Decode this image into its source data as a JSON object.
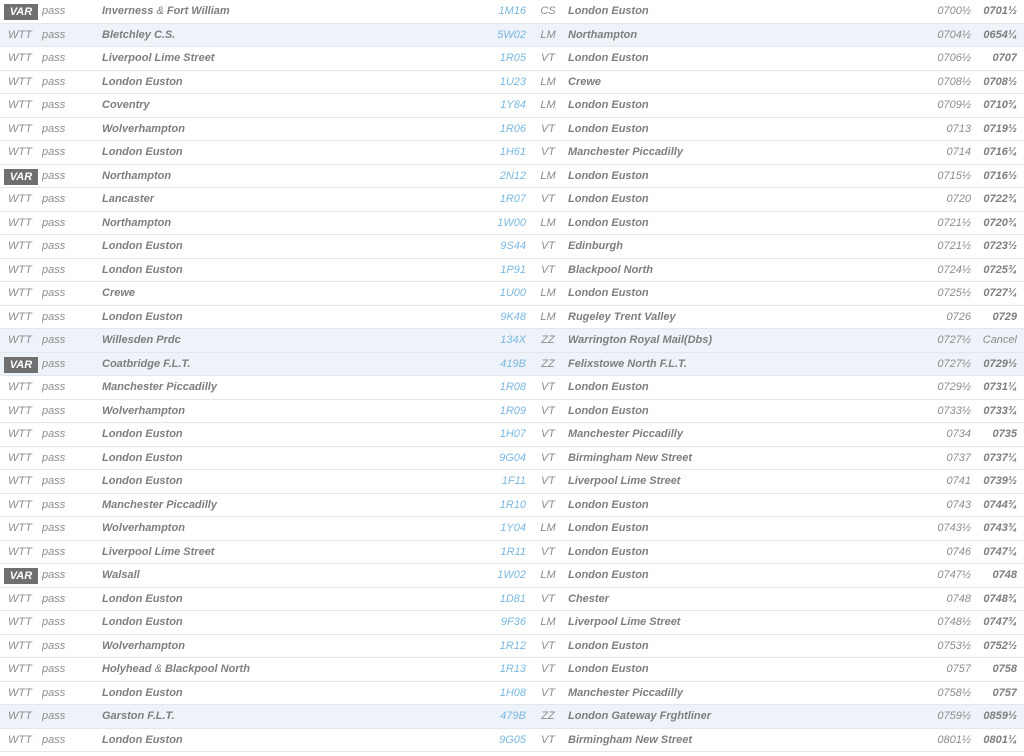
{
  "rows": [
    {
      "type": "VAR",
      "mode": "pass",
      "origin": "Inverness",
      "origin2": "Fort William",
      "headcode": "1M16",
      "operator": "CS",
      "destination": "London Euston",
      "booked": "0700½",
      "actual": "0701½",
      "shaded": false
    },
    {
      "type": "WTT",
      "mode": "pass",
      "origin": "Bletchley C.S.",
      "origin2": "",
      "headcode": "5W02",
      "operator": "LM",
      "destination": "Northampton",
      "booked": "0704½",
      "actual": "0654¼",
      "shaded": true
    },
    {
      "type": "WTT",
      "mode": "pass",
      "origin": "Liverpool Lime Street",
      "origin2": "",
      "headcode": "1R05",
      "operator": "VT",
      "destination": "London Euston",
      "booked": "0706½",
      "actual": "0707",
      "shaded": false
    },
    {
      "type": "WTT",
      "mode": "pass",
      "origin": "London Euston",
      "origin2": "",
      "headcode": "1U23",
      "operator": "LM",
      "destination": "Crewe",
      "booked": "0708½",
      "actual": "0708½",
      "shaded": false
    },
    {
      "type": "WTT",
      "mode": "pass",
      "origin": "Coventry",
      "origin2": "",
      "headcode": "1Y84",
      "operator": "LM",
      "destination": "London Euston",
      "booked": "0709½",
      "actual": "0710¾",
      "shaded": false
    },
    {
      "type": "WTT",
      "mode": "pass",
      "origin": "Wolverhampton",
      "origin2": "",
      "headcode": "1R06",
      "operator": "VT",
      "destination": "London Euston",
      "booked": "0713",
      "actual": "0719½",
      "shaded": false
    },
    {
      "type": "WTT",
      "mode": "pass",
      "origin": "London Euston",
      "origin2": "",
      "headcode": "1H61",
      "operator": "VT",
      "destination": "Manchester Piccadilly",
      "booked": "0714",
      "actual": "0716¼",
      "shaded": false
    },
    {
      "type": "VAR",
      "mode": "pass",
      "origin": "Northampton",
      "origin2": "",
      "headcode": "2N12",
      "operator": "LM",
      "destination": "London Euston",
      "booked": "0715½",
      "actual": "0716½",
      "shaded": false
    },
    {
      "type": "WTT",
      "mode": "pass",
      "origin": "Lancaster",
      "origin2": "",
      "headcode": "1R07",
      "operator": "VT",
      "destination": "London Euston",
      "booked": "0720",
      "actual": "0722¾",
      "shaded": false
    },
    {
      "type": "WTT",
      "mode": "pass",
      "origin": "Northampton",
      "origin2": "",
      "headcode": "1W00",
      "operator": "LM",
      "destination": "London Euston",
      "booked": "0721½",
      "actual": "0720¾",
      "shaded": false
    },
    {
      "type": "WTT",
      "mode": "pass",
      "origin": "London Euston",
      "origin2": "",
      "headcode": "9S44",
      "operator": "VT",
      "destination": "Edinburgh",
      "booked": "0721½",
      "actual": "0723½",
      "shaded": false
    },
    {
      "type": "WTT",
      "mode": "pass",
      "origin": "London Euston",
      "origin2": "",
      "headcode": "1P91",
      "operator": "VT",
      "destination": "Blackpool North",
      "booked": "0724½",
      "actual": "0725¾",
      "shaded": false
    },
    {
      "type": "WTT",
      "mode": "pass",
      "origin": "Crewe",
      "origin2": "",
      "headcode": "1U00",
      "operator": "LM",
      "destination": "London Euston",
      "booked": "0725½",
      "actual": "0727¼",
      "shaded": false
    },
    {
      "type": "WTT",
      "mode": "pass",
      "origin": "London Euston",
      "origin2": "",
      "headcode": "9K48",
      "operator": "LM",
      "destination": "Rugeley Trent Valley",
      "booked": "0726",
      "actual": "0729",
      "shaded": false
    },
    {
      "type": "WTT",
      "mode": "pass",
      "origin": "Willesden Prdc",
      "origin2": "",
      "headcode": "134X",
      "operator": "ZZ",
      "destination": "Warrington Royal Mail(Dbs)",
      "booked": "0727½",
      "actual": "Cancel",
      "shaded": true
    },
    {
      "type": "VAR",
      "mode": "pass",
      "origin": "Coatbridge F.L.T.",
      "origin2": "",
      "headcode": "419B",
      "operator": "ZZ",
      "destination": "Felixstowe North F.L.T.",
      "booked": "0727½",
      "actual": "0729½",
      "shaded": true
    },
    {
      "type": "WTT",
      "mode": "pass",
      "origin": "Manchester Piccadilly",
      "origin2": "",
      "headcode": "1R08",
      "operator": "VT",
      "destination": "London Euston",
      "booked": "0729½",
      "actual": "0731¼",
      "shaded": false
    },
    {
      "type": "WTT",
      "mode": "pass",
      "origin": "Wolverhampton",
      "origin2": "",
      "headcode": "1R09",
      "operator": "VT",
      "destination": "London Euston",
      "booked": "0733½",
      "actual": "0733¾",
      "shaded": false
    },
    {
      "type": "WTT",
      "mode": "pass",
      "origin": "London Euston",
      "origin2": "",
      "headcode": "1H07",
      "operator": "VT",
      "destination": "Manchester Piccadilly",
      "booked": "0734",
      "actual": "0735",
      "shaded": false
    },
    {
      "type": "WTT",
      "mode": "pass",
      "origin": "London Euston",
      "origin2": "",
      "headcode": "9G04",
      "operator": "VT",
      "destination": "Birmingham New Street",
      "booked": "0737",
      "actual": "0737¼",
      "shaded": false
    },
    {
      "type": "WTT",
      "mode": "pass",
      "origin": "London Euston",
      "origin2": "",
      "headcode": "1F11",
      "operator": "VT",
      "destination": "Liverpool Lime Street",
      "booked": "0741",
      "actual": "0739½",
      "shaded": false
    },
    {
      "type": "WTT",
      "mode": "pass",
      "origin": "Manchester Piccadilly",
      "origin2": "",
      "headcode": "1R10",
      "operator": "VT",
      "destination": "London Euston",
      "booked": "0743",
      "actual": "0744¾",
      "shaded": false
    },
    {
      "type": "WTT",
      "mode": "pass",
      "origin": "Wolverhampton",
      "origin2": "",
      "headcode": "1Y04",
      "operator": "LM",
      "destination": "London Euston",
      "booked": "0743½",
      "actual": "0743¾",
      "shaded": false
    },
    {
      "type": "WTT",
      "mode": "pass",
      "origin": "Liverpool Lime Street",
      "origin2": "",
      "headcode": "1R11",
      "operator": "VT",
      "destination": "London Euston",
      "booked": "0746",
      "actual": "0747¼",
      "shaded": false
    },
    {
      "type": "VAR",
      "mode": "pass",
      "origin": "Walsall",
      "origin2": "",
      "headcode": "1W02",
      "operator": "LM",
      "destination": "London Euston",
      "booked": "0747½",
      "actual": "0748",
      "shaded": false
    },
    {
      "type": "WTT",
      "mode": "pass",
      "origin": "London Euston",
      "origin2": "",
      "headcode": "1D81",
      "operator": "VT",
      "destination": "Chester",
      "booked": "0748",
      "actual": "0748¾",
      "shaded": false
    },
    {
      "type": "WTT",
      "mode": "pass",
      "origin": "London Euston",
      "origin2": "",
      "headcode": "9F36",
      "operator": "LM",
      "destination": "Liverpool Lime Street",
      "booked": "0748½",
      "actual": "0747¾",
      "shaded": false
    },
    {
      "type": "WTT",
      "mode": "pass",
      "origin": "Wolverhampton",
      "origin2": "",
      "headcode": "1R12",
      "operator": "VT",
      "destination": "London Euston",
      "booked": "0753½",
      "actual": "0752½",
      "shaded": false
    },
    {
      "type": "WTT",
      "mode": "pass",
      "origin": "Holyhead",
      "origin2": "Blackpool North",
      "headcode": "1R13",
      "operator": "VT",
      "destination": "London Euston",
      "booked": "0757",
      "actual": "0758",
      "shaded": false
    },
    {
      "type": "WTT",
      "mode": "pass",
      "origin": "London Euston",
      "origin2": "",
      "headcode": "1H08",
      "operator": "VT",
      "destination": "Manchester Piccadilly",
      "booked": "0758½",
      "actual": "0757",
      "shaded": false
    },
    {
      "type": "WTT",
      "mode": "pass",
      "origin": "Garston F.L.T.",
      "origin2": "",
      "headcode": "479B",
      "operator": "ZZ",
      "destination": "London Gateway Frghtliner",
      "booked": "0759½",
      "actual": "0859½",
      "shaded": true
    },
    {
      "type": "WTT",
      "mode": "pass",
      "origin": "London Euston",
      "origin2": "",
      "headcode": "9G05",
      "operator": "VT",
      "destination": "Birmingham New Street",
      "booked": "0801½",
      "actual": "0801¼",
      "shaded": false
    }
  ],
  "joiner": "&",
  "colors": {
    "headcode": "#7ab8e0",
    "var_badge_bg": "#6f6f6f",
    "shaded_row": "#eef2f9",
    "row_divider": "#e3e6ea"
  }
}
